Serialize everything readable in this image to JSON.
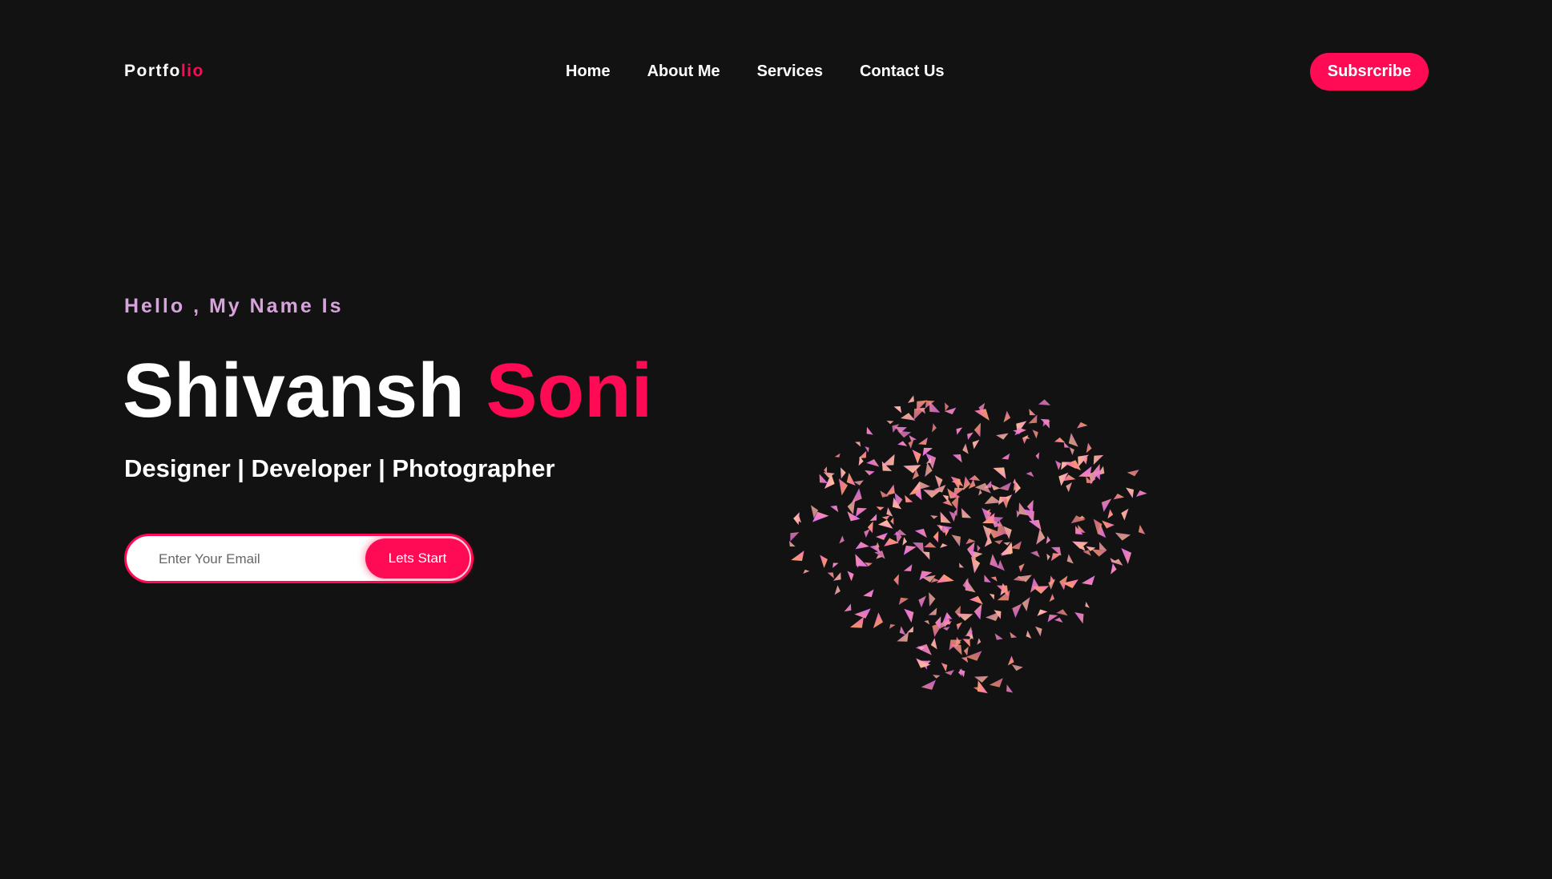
{
  "nav": {
    "logo_main": "Portfo",
    "logo_accent": "lio",
    "links": [
      "Home",
      "About Me",
      "Services",
      "Contact Us"
    ],
    "subscribe_label": "Subsrcribe"
  },
  "hero": {
    "greeting": "Hello , My Name Is",
    "first_name": "Shivansh",
    "last_name": "Soni",
    "roles": "Designer | Developer | Photographer"
  },
  "signup": {
    "email_placeholder": "Enter Your Email",
    "email_value": "",
    "button_label": "Lets Start"
  },
  "colors": {
    "background": "#121212",
    "accent": "#ff0a54",
    "greeting": "#d7a3dc",
    "text": "#ffffff"
  },
  "decoration": {
    "icon": "particle-swarm-graphic"
  }
}
